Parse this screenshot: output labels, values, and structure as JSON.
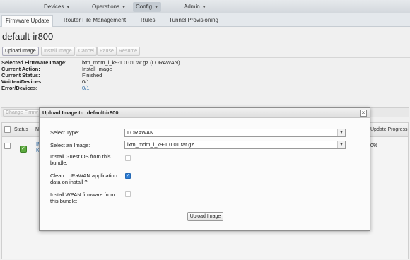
{
  "topnav": {
    "items": [
      {
        "label": "Devices",
        "has_menu": true
      },
      {
        "label": "Operations",
        "has_menu": true
      },
      {
        "label": "Config",
        "has_menu": true
      },
      {
        "label": "Admin",
        "has_menu": true
      }
    ],
    "active": "Config",
    "caret_glyph": "▼"
  },
  "tabs": [
    {
      "label": "Firmware Update",
      "active": true
    },
    {
      "label": "Router File Management",
      "active": false
    },
    {
      "label": "Rules",
      "active": false
    },
    {
      "label": "Tunnel Provisioning",
      "active": false
    }
  ],
  "page_title": "default-ir800",
  "toolbar": {
    "buttons": [
      {
        "label": "Upload Image",
        "enabled": true
      },
      {
        "label": "Install Image",
        "enabled": false
      },
      {
        "label": "Cancel",
        "enabled": false
      },
      {
        "label": "Pause",
        "enabled": false
      },
      {
        "label": "Resume",
        "enabled": false
      }
    ]
  },
  "info": [
    {
      "label": "Selected Firmware Image:",
      "value": "ixm_mdm_i_k9-1.0.01.tar.gz (LORAWAN)",
      "link": false
    },
    {
      "label": "Current Action:",
      "value": "Install Image",
      "link": false
    },
    {
      "label": "Current Status:",
      "value": "Finished",
      "link": false
    },
    {
      "label": "Written/Devices:",
      "value": "0/1",
      "link": false
    },
    {
      "label": "Error/Devices:",
      "value": "0/1",
      "link": true
    }
  ],
  "grid": {
    "toolbar_button": "Change Firmw",
    "columns": {
      "status": "Status",
      "name": "N",
      "progress": "Update Progress"
    },
    "row": {
      "name_partial_1": "IF",
      "name_partial_2": "K",
      "progress": "0%",
      "status": "ok"
    }
  },
  "modal": {
    "title": "Upload Image to: default-ir800",
    "close_glyph": "×",
    "select_type_label": "Select Type:",
    "select_type_value": "LORAWAN",
    "select_image_label": "Select an Image:",
    "select_image_value": "ixm_mdm_i_k9-1.0.01.tar.gz",
    "install_guest_os_label": "Install Guest OS from this bundle:",
    "install_guest_os_checked": false,
    "clean_lorawan_label": "Clean LoRaWAN application data on install ?:",
    "clean_lorawan_checked": true,
    "install_wpan_label": "Install WPAN firmware from this bundle:",
    "install_wpan_checked": false,
    "upload_button": "Upload Image",
    "select_arrow_glyph": "▼",
    "check_glyph": "✓"
  },
  "colors": {
    "accent": "#2f7fd6",
    "link": "#2a6aa8",
    "status_ok": "#5caa3e"
  }
}
